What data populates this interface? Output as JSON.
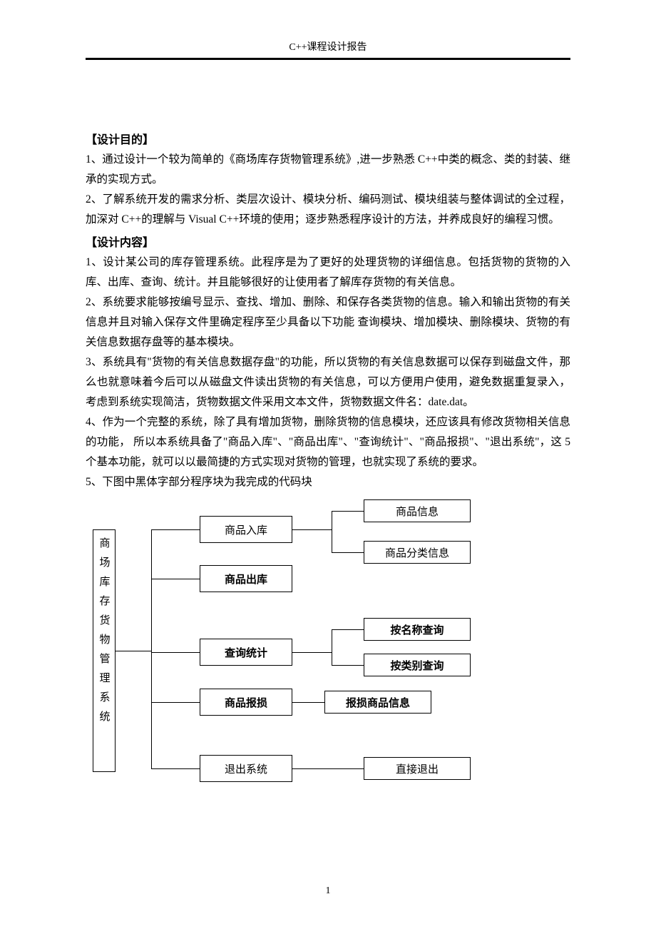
{
  "header": "C++课程设计报告",
  "section1": {
    "title": "【设计目的】",
    "p1": "1、通过设计一个较为简单的《商场库存货物管理系统》,进一步熟悉 C++中类的概念、类的封装、继承的实现方式。",
    "p2": "2、了解系统开发的需求分析、类层次设计、模块分析、编码测试、模块组装与整体调试的全过程，加深对 C++的理解与 Visual C++环境的使用；逐步熟悉程序设计的方法，并养成良好的编程习惯。"
  },
  "section2": {
    "title": "【设计内容】",
    "p1": "1、设计某公司的库存管理系统。此程序是为了更好的处理货物的详细信息。包括货物的货物的入库、出库、查询、统计。并且能够很好的让使用者了解库存货物的有关信息。",
    "p2": "2、系统要求能够按编号显示、查找、增加、删除、和保存各类货物的信息。输入和输出货物的有关信息并且对输入保存文件里确定程序至少具备以下功能 查询模块、增加模块、删除模块、货物的有关信息数据存盘等的基本模块。",
    "p3": "3、系统具有\"货物的有关信息数据存盘\"的功能，所以货物的有关信息数据可以保存到磁盘文件，那么也就意味着今后可以从磁盘文件读出货物的有关信息，可以方便用户使用，避免数据重复录入，考虑到系统实现简洁，货物数据文件采用文本文件，货物数据文件名：date.dat。",
    "p4": "4、作为一个完整的系统，除了具有增加货物，删除货物的信息模块，还应该具有修改货物相关信息的功能，  所以本系统具备了\"商品入库\"、\"商品出库\"、\"查询统计\"、\"商品报损\"、\"退出系统\"，这 5 个基本功能，就可以以最简捷的方式实现对货物的管理，也就实现了系统的要求。",
    "p5": "5、下图中黑体字部分程序块为我完成的代码块"
  },
  "diagram": {
    "root": "商场库存货物管理系统",
    "level2": {
      "n1": "商品入库",
      "n2": "商品出库",
      "n3": "查询统计",
      "n4": "商品报损",
      "n5": "退出系统"
    },
    "level3": {
      "n1a": "商品信息",
      "n1b": "商品分类信息",
      "n3a": "按名称查询",
      "n3b": "按类别查询",
      "n4a": "报损商品信息",
      "n5a": "直接退出"
    }
  },
  "pageNumber": "1"
}
